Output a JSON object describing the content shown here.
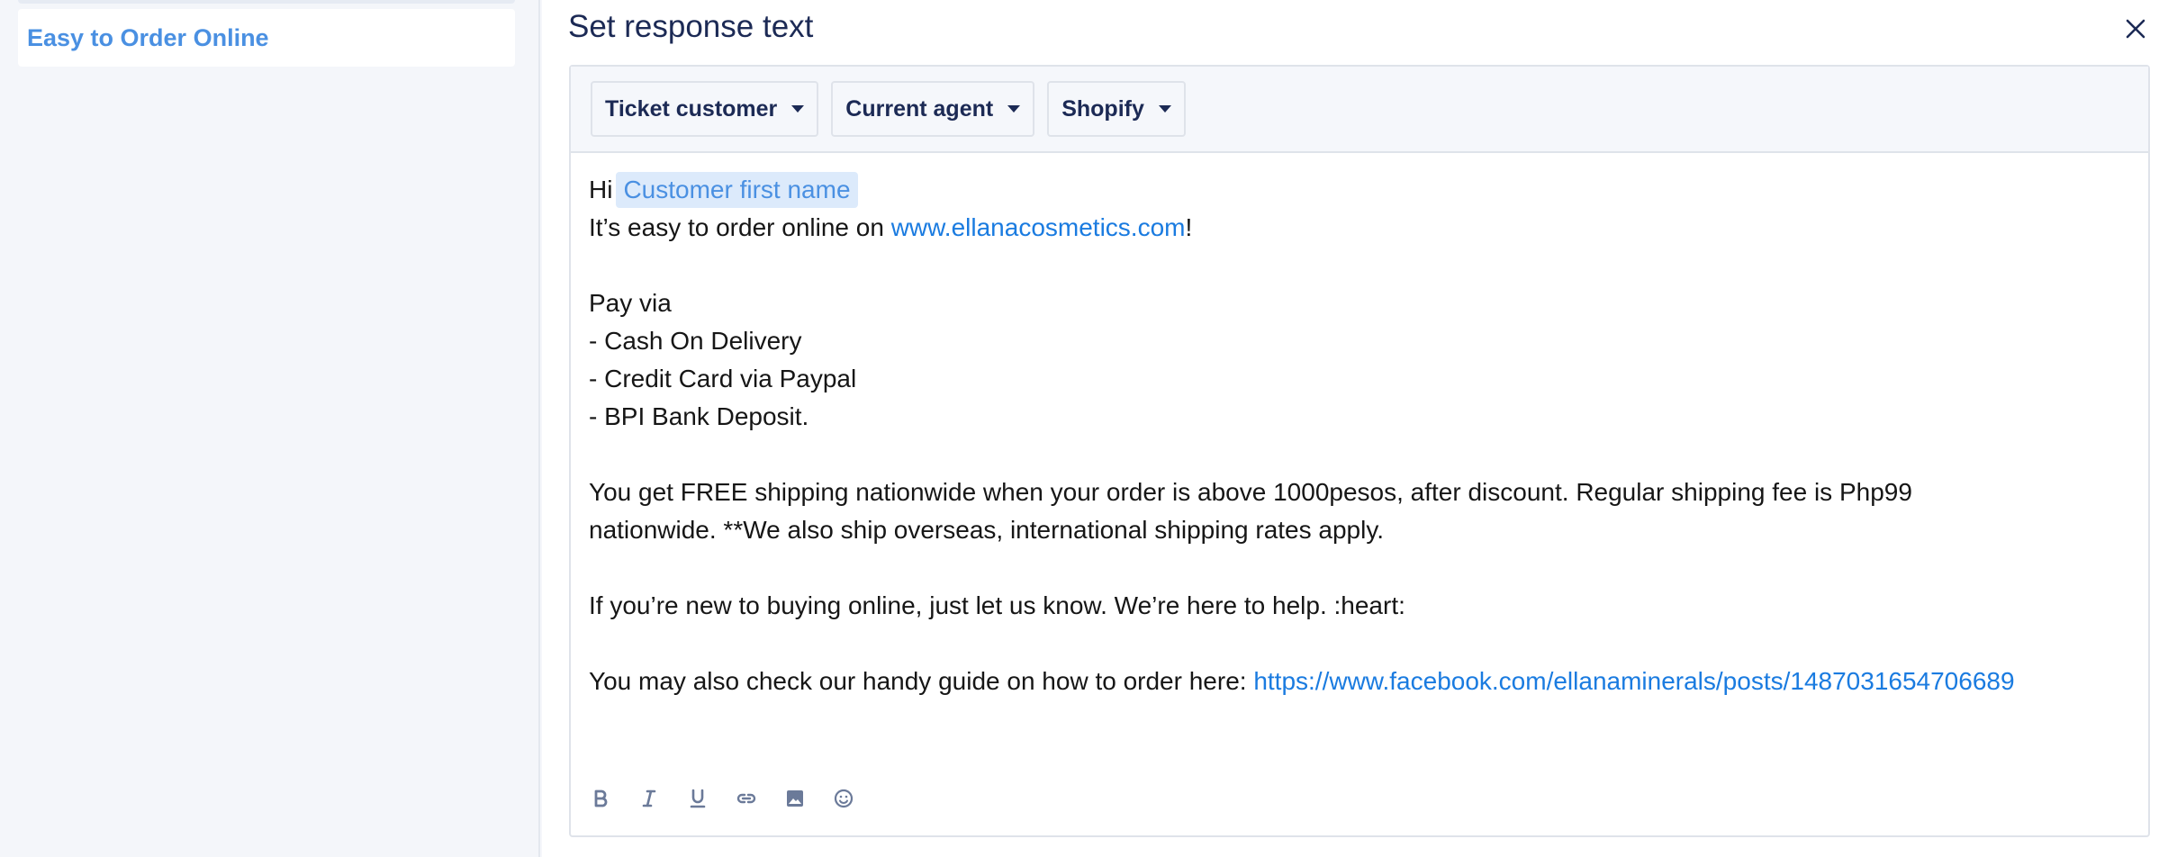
{
  "sidebar": {
    "items": [
      {
        "label": "Easy to Order Online"
      }
    ]
  },
  "panel": {
    "title": "Set response text",
    "close_icon": "close-icon"
  },
  "variables": {
    "dropdowns": [
      {
        "label": "Ticket customer"
      },
      {
        "label": "Current agent"
      },
      {
        "label": "Shopify"
      }
    ]
  },
  "editor": {
    "greeting": "Hi",
    "customer_var": "Customer first name",
    "line2_prefix": "It’s easy to order online on ",
    "line2_link": "www.ellanacosmetics.com",
    "line2_suffix": "!",
    "pay_via": "Pay via",
    "pay_cod": "- Cash On Delivery",
    "pay_card": "- Credit Card via Paypal",
    "pay_bpi": "- BPI Bank Deposit.",
    "shipping_1": "You get FREE shipping nationwide when your order is above 1000pesos, after discount. Regular shipping fee is Php99",
    "shipping_2": "nationwide. **We also ship overseas, international shipping rates apply.",
    "new_buyer": "If you’re new to buying online, just let us know. We’re here to help. :heart:",
    "guide_prefix": "You may also check our handy guide on how to order here: ",
    "guide_link": "https://www.facebook.com/ellanaminerals/posts/1487031654706689"
  },
  "toolbar": {
    "icons": [
      "bold-icon",
      "italic-icon",
      "underline-icon",
      "link-icon",
      "image-icon",
      "emoji-icon"
    ]
  },
  "colors": {
    "accent": "#4a90e2",
    "link": "#1a7be0",
    "title": "#1c2a55",
    "icon": "#6b7a99"
  }
}
